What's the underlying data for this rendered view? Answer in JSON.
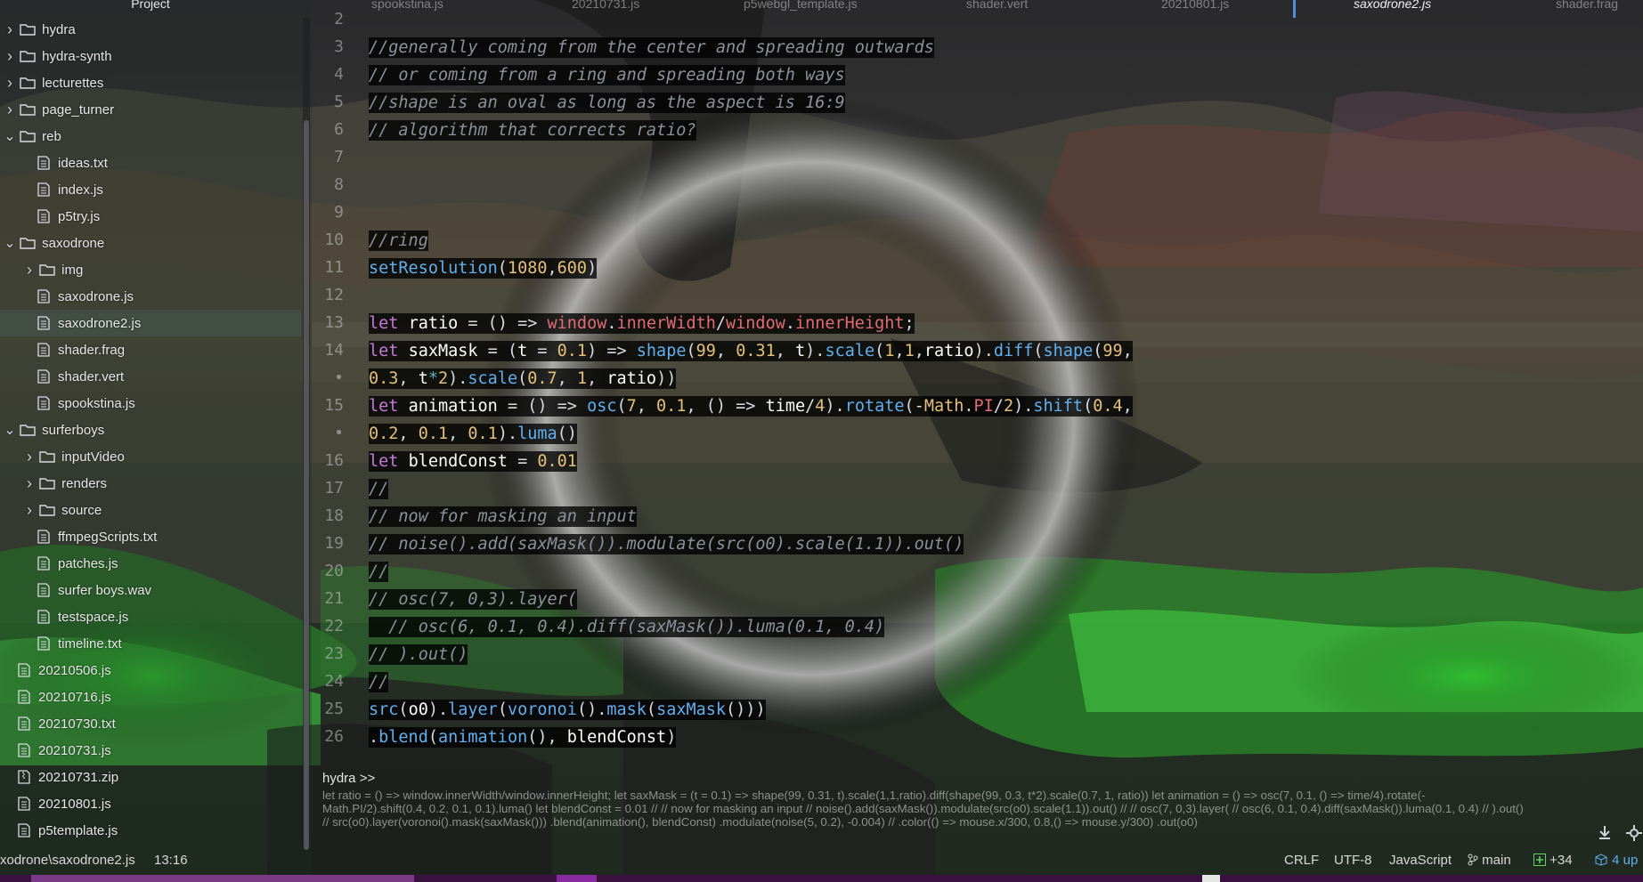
{
  "tree": {
    "header": "Project",
    "items": [
      {
        "label": "hydra",
        "kind": "folder",
        "state": "collapsed",
        "depth": 0
      },
      {
        "label": "hydra-synth",
        "kind": "folder",
        "state": "collapsed",
        "depth": 0
      },
      {
        "label": "lecturettes",
        "kind": "folder",
        "state": "collapsed",
        "depth": 0
      },
      {
        "label": "page_turner",
        "kind": "folder",
        "state": "collapsed",
        "depth": 0
      },
      {
        "label": "reb",
        "kind": "folder",
        "state": "expanded",
        "depth": 0
      },
      {
        "label": "ideas.txt",
        "kind": "file",
        "depth": 1
      },
      {
        "label": "index.js",
        "kind": "file",
        "depth": 1
      },
      {
        "label": "p5try.js",
        "kind": "file",
        "depth": 1
      },
      {
        "label": "saxodrone",
        "kind": "folder",
        "state": "expanded",
        "depth": 0
      },
      {
        "label": "img",
        "kind": "folder",
        "state": "collapsed",
        "depth": 1
      },
      {
        "label": "saxodrone.js",
        "kind": "file",
        "depth": 1
      },
      {
        "label": "saxodrone2.js",
        "kind": "file",
        "depth": 1,
        "selected": true
      },
      {
        "label": "shader.frag",
        "kind": "file",
        "depth": 1
      },
      {
        "label": "shader.vert",
        "kind": "file",
        "depth": 1
      },
      {
        "label": "spookstina.js",
        "kind": "file",
        "depth": 1
      },
      {
        "label": "surferboys",
        "kind": "folder",
        "state": "expanded",
        "depth": 0
      },
      {
        "label": "inputVideo",
        "kind": "folder",
        "state": "collapsed",
        "depth": 1
      },
      {
        "label": "renders",
        "kind": "folder",
        "state": "collapsed",
        "depth": 1
      },
      {
        "label": "source",
        "kind": "folder",
        "state": "collapsed",
        "depth": 1
      },
      {
        "label": "ffmpegScripts.txt",
        "kind": "file",
        "depth": 1
      },
      {
        "label": "patches.js",
        "kind": "file",
        "depth": 1
      },
      {
        "label": "surfer boys.wav",
        "kind": "file",
        "depth": 1
      },
      {
        "label": "testspace.js",
        "kind": "file",
        "depth": 1
      },
      {
        "label": "timeline.txt",
        "kind": "file",
        "depth": 1
      },
      {
        "label": "20210506.js",
        "kind": "file",
        "depth": 0
      },
      {
        "label": "20210716.js",
        "kind": "file",
        "depth": 0
      },
      {
        "label": "20210730.txt",
        "kind": "file",
        "depth": 0
      },
      {
        "label": "20210731.js",
        "kind": "file",
        "depth": 0
      },
      {
        "label": "20210731.zip",
        "kind": "zip",
        "depth": 0
      },
      {
        "label": "20210801.js",
        "kind": "file",
        "depth": 0
      },
      {
        "label": "p5template.js",
        "kind": "file",
        "depth": 0
      }
    ]
  },
  "tabs": [
    {
      "label": "spookstina.js"
    },
    {
      "label": "20210731.js"
    },
    {
      "label": "p5webgl_template.js"
    },
    {
      "label": "shader.vert"
    },
    {
      "label": "20210801.js"
    },
    {
      "label": "saxodrone2.js",
      "active": true
    },
    {
      "label": "shader.frag"
    }
  ],
  "editor": {
    "lines": [
      {
        "n": "2",
        "parts": []
      },
      {
        "n": "3",
        "parts": [
          [
            "cmt",
            "//generally coming from the center and spreading outwards"
          ]
        ]
      },
      {
        "n": "4",
        "parts": [
          [
            "cmt",
            "// or coming from a ring and spreading both ways"
          ]
        ]
      },
      {
        "n": "5",
        "parts": [
          [
            "cmt",
            "//shape is an oval as long as the aspect is 16:9"
          ]
        ]
      },
      {
        "n": "6",
        "parts": [
          [
            "cmt",
            "// algorithm that corrects ratio?"
          ]
        ]
      },
      {
        "n": "7",
        "parts": []
      },
      {
        "n": "8",
        "parts": []
      },
      {
        "n": "9",
        "parts": []
      },
      {
        "n": "10",
        "parts": [
          [
            "cmt",
            "//ring"
          ]
        ]
      },
      {
        "n": "11",
        "parts": [
          [
            "fn",
            "setResolution"
          ],
          [
            "op",
            "("
          ],
          [
            "num",
            "1080"
          ],
          [
            "op",
            ","
          ],
          [
            "num",
            "600"
          ],
          [
            "op",
            ")"
          ]
        ]
      },
      {
        "n": "12",
        "parts": []
      },
      {
        "n": "13",
        "parts": [
          [
            "kw",
            "let"
          ],
          [
            "op",
            " "
          ],
          [
            "var",
            "ratio"
          ],
          [
            "op",
            " = () => "
          ],
          [
            "red",
            "window"
          ],
          [
            "op",
            "."
          ],
          [
            "red",
            "innerWidth"
          ],
          [
            "op",
            "/"
          ],
          [
            "red",
            "window"
          ],
          [
            "op",
            "."
          ],
          [
            "red",
            "innerHeight"
          ],
          [
            "op",
            ";"
          ]
        ]
      },
      {
        "n": "14",
        "parts": [
          [
            "kw",
            "let"
          ],
          [
            "op",
            " "
          ],
          [
            "var",
            "saxMask"
          ],
          [
            "op",
            " = ("
          ],
          [
            "var",
            "t"
          ],
          [
            "op",
            " = "
          ],
          [
            "num",
            "0.1"
          ],
          [
            "op",
            ") => "
          ],
          [
            "fn",
            "shape"
          ],
          [
            "op",
            "("
          ],
          [
            "num",
            "99"
          ],
          [
            "op",
            ", "
          ],
          [
            "num",
            "0.31"
          ],
          [
            "op",
            ", "
          ],
          [
            "var",
            "t"
          ],
          [
            "op",
            ")."
          ],
          [
            "fn",
            "scale"
          ],
          [
            "op",
            "("
          ],
          [
            "num",
            "1"
          ],
          [
            "op",
            ","
          ],
          [
            "num",
            "1"
          ],
          [
            "op",
            ","
          ],
          [
            "var",
            "ratio"
          ],
          [
            "op",
            ")."
          ],
          [
            "fn",
            "diff"
          ],
          [
            "op",
            "("
          ],
          [
            "fn",
            "shape"
          ],
          [
            "op",
            "("
          ],
          [
            "num",
            "99"
          ],
          [
            "op",
            ","
          ]
        ]
      },
      {
        "n": "•",
        "parts": [
          [
            "num",
            "0.3"
          ],
          [
            "op",
            ", "
          ],
          [
            "var",
            "t"
          ],
          [
            "cyan",
            "*"
          ],
          [
            "num",
            "2"
          ],
          [
            "op",
            ")."
          ],
          [
            "fn",
            "scale"
          ],
          [
            "op",
            "("
          ],
          [
            "num",
            "0.7"
          ],
          [
            "op",
            ", "
          ],
          [
            "num",
            "1"
          ],
          [
            "op",
            ", "
          ],
          [
            "var",
            "ratio"
          ],
          [
            "op",
            "))"
          ]
        ]
      },
      {
        "n": "15",
        "parts": [
          [
            "kw",
            "let"
          ],
          [
            "op",
            " "
          ],
          [
            "var",
            "animation"
          ],
          [
            "op",
            " = () => "
          ],
          [
            "fn",
            "osc"
          ],
          [
            "op",
            "("
          ],
          [
            "num",
            "7"
          ],
          [
            "op",
            ", "
          ],
          [
            "num",
            "0.1"
          ],
          [
            "op",
            ", () => "
          ],
          [
            "var",
            "time"
          ],
          [
            "op",
            "/"
          ],
          [
            "num",
            "4"
          ],
          [
            "op",
            ")."
          ],
          [
            "fn",
            "rotate"
          ],
          [
            "op",
            "(-"
          ],
          [
            "num",
            "Math"
          ],
          [
            "op",
            "."
          ],
          [
            "red",
            "PI"
          ],
          [
            "op",
            "/"
          ],
          [
            "num",
            "2"
          ],
          [
            "op",
            ")."
          ],
          [
            "fn",
            "shift"
          ],
          [
            "op",
            "("
          ],
          [
            "num",
            "0.4"
          ],
          [
            "op",
            ","
          ]
        ]
      },
      {
        "n": "•",
        "parts": [
          [
            "num",
            "0.2"
          ],
          [
            "op",
            ", "
          ],
          [
            "num",
            "0.1"
          ],
          [
            "op",
            ", "
          ],
          [
            "num",
            "0.1"
          ],
          [
            "op",
            ")."
          ],
          [
            "fn",
            "luma"
          ],
          [
            "op",
            "()"
          ]
        ]
      },
      {
        "n": "16",
        "parts": [
          [
            "kw",
            "let"
          ],
          [
            "op",
            " "
          ],
          [
            "var",
            "blendConst"
          ],
          [
            "op",
            " = "
          ],
          [
            "num",
            "0.01"
          ]
        ]
      },
      {
        "n": "17",
        "parts": [
          [
            "cmt",
            "//"
          ]
        ]
      },
      {
        "n": "18",
        "parts": [
          [
            "cmt",
            "// now for masking an input"
          ]
        ]
      },
      {
        "n": "19",
        "parts": [
          [
            "cmt",
            "// noise().add(saxMask()).modulate(src(o0).scale(1.1)).out()"
          ]
        ]
      },
      {
        "n": "20",
        "parts": [
          [
            "cmt",
            "//"
          ]
        ]
      },
      {
        "n": "21",
        "parts": [
          [
            "cmt",
            "// osc(7, 0,3).layer("
          ]
        ]
      },
      {
        "n": "22",
        "parts": [
          [
            "cmt",
            "  // osc(6, 0.1, 0.4).diff(saxMask()).luma(0.1, 0.4)"
          ]
        ]
      },
      {
        "n": "23",
        "parts": [
          [
            "cmt",
            "// ).out()"
          ]
        ]
      },
      {
        "n": "24",
        "parts": [
          [
            "cmt",
            "//"
          ]
        ]
      },
      {
        "n": "25",
        "parts": [
          [
            "fn",
            "src"
          ],
          [
            "op",
            "("
          ],
          [
            "var",
            "o0"
          ],
          [
            "op",
            ")."
          ],
          [
            "fn",
            "layer"
          ],
          [
            "op",
            "("
          ],
          [
            "fn",
            "voronoi"
          ],
          [
            "op",
            "()."
          ],
          [
            "fn",
            "mask"
          ],
          [
            "op",
            "("
          ],
          [
            "fn",
            "saxMask"
          ],
          [
            "op",
            "()))"
          ]
        ]
      },
      {
        "n": "26",
        "parts": [
          [
            "op",
            "."
          ],
          [
            "fn",
            "blend"
          ],
          [
            "op",
            "("
          ],
          [
            "fn",
            "animation"
          ],
          [
            "op",
            "(), "
          ],
          [
            "var",
            "blendConst"
          ],
          [
            "op",
            ")"
          ]
        ]
      }
    ]
  },
  "console": {
    "prompt": "hydra >>",
    "output_lines": [
      "let ratio = () => window.innerWidth/window.innerHeight; let saxMask = (t = 0.1) => shape(99, 0.31, t).scale(1,1,ratio).diff(shape(99, 0.3, t*2).scale(0.7, 1, ratio)) let animation = () => osc(7, 0.1, () => time/4).rotate(-",
      "Math.PI/2).shift(0.4, 0.2, 0.1, 0.1).luma() let blendConst = 0.01 // // now for masking an input // noise().add(saxMask()).modulate(src(o0).scale(1.1)).out() // // osc(7, 0,3).layer( // osc(6, 0.1, 0.4).diff(saxMask()).luma(0.1, 0.4) // ).out()",
      "// src(o0).layer(voronoi().mask(saxMask())) .blend(animation(), blendConst) .modulate(noise(5, 0.2), -0.004) // .color(() => mouse.x/300, 0.8,() => mouse.y/300) .out(o0)"
    ]
  },
  "status": {
    "path": "xodrone\\saxodrone2.js",
    "cursor": "13:16",
    "line_ending": "CRLF",
    "encoding": "UTF-8",
    "grammar": "JavaScript",
    "branch": "main",
    "changes": "+34",
    "updates": "4 up"
  },
  "colors": {
    "keyword": "#c678dd",
    "function": "#61afef",
    "number": "#e5c07b",
    "comment": "#8d9199",
    "accent": "#4d8fe0"
  }
}
